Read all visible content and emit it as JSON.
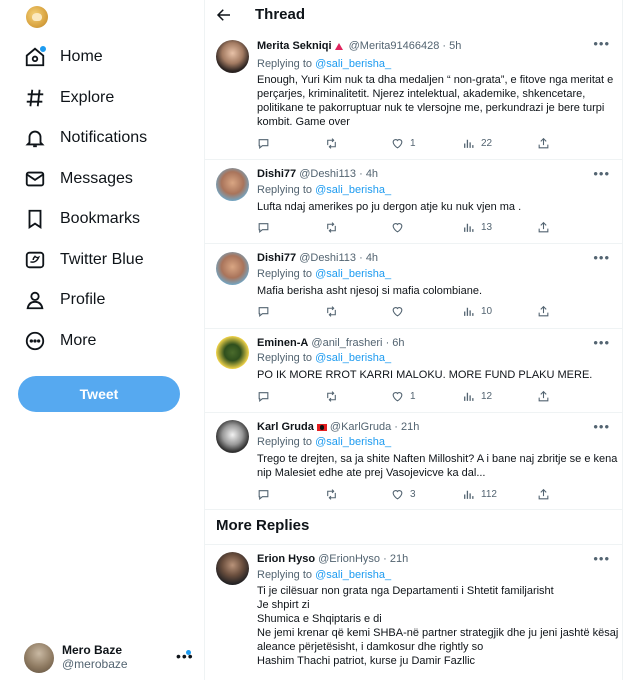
{
  "sidebar": {
    "nav": [
      {
        "label": "Home",
        "icon": "home-icon"
      },
      {
        "label": "Explore",
        "icon": "hashtag-icon"
      },
      {
        "label": "Notifications",
        "icon": "bell-icon"
      },
      {
        "label": "Messages",
        "icon": "envelope-icon"
      },
      {
        "label": "Bookmarks",
        "icon": "bookmark-icon"
      },
      {
        "label": "Twitter Blue",
        "icon": "twitter-blue-icon"
      },
      {
        "label": "Profile",
        "icon": "person-icon"
      },
      {
        "label": "More",
        "icon": "more-circle-icon"
      }
    ],
    "tweet_button": "Tweet",
    "account": {
      "name": "Mero Baze",
      "handle": "@merobaze"
    }
  },
  "header": {
    "title": "Thread"
  },
  "colors": {
    "accent": "#1d9bf0",
    "tweet_button": "#56a9f0"
  },
  "tweets": [
    {
      "name": "Merita Sekniqi",
      "handle": "@Merita91466428",
      "time": "· 5h",
      "replying_prefix": "Replying to ",
      "replying_to": "@sali_berisha_",
      "lines": [
        "Enough, Yuri Kim nuk ta dha medaljen “ non-grata”, e fitove nga meritat e",
        "perçarjes, kriminalitetit. Njerez intelektual, akademike, shkencetare,",
        "politikane te pakorruptuar nuk te vlersojne me, perkundrazi je bere turpi",
        "kombit. Game over"
      ],
      "likes": "1",
      "views": "22"
    },
    {
      "name": "Dishi77",
      "handle": "@Deshi113",
      "time": "· 4h",
      "replying_prefix": "Replying to ",
      "replying_to": "@sali_berisha_",
      "lines": [
        "Lufta ndaj amerikes po ju dergon atje ku nuk vjen ma ."
      ],
      "likes": "",
      "views": "13"
    },
    {
      "name": "Dishi77",
      "handle": "@Deshi113",
      "time": "· 4h",
      "replying_prefix": "Replying to ",
      "replying_to": "@sali_berisha_",
      "lines": [
        "Mafia berisha asht njesoj si mafia colombiane."
      ],
      "likes": "",
      "views": "10"
    },
    {
      "name": "Eminen-A",
      "handle": "@anil_frasheri",
      "time": "· 6h",
      "replying_prefix": "Replying to ",
      "replying_to": "@sali_berisha_",
      "lines": [
        "PO IK MORE RROT KARRI MALOKU. MORE FUND PLAKU MERE."
      ],
      "likes": "1",
      "views": "12"
    },
    {
      "name": "Karl Gruda",
      "handle": "@KarlGruda",
      "time": "· 21h",
      "replying_prefix": "Replying to ",
      "replying_to": "@sali_berisha_",
      "lines": [
        "Trego te drejten, sa ja shite Naften Milloshit? A i bane naj zbritje se e kena",
        "nip Malesiet edhe ate prej Vasojevicve ka dal..."
      ],
      "likes": "3",
      "views": "112"
    },
    {
      "name": "Erion Hyso",
      "handle": "@ErionHyso",
      "time": "· 21h",
      "replying_prefix": "Replying to ",
      "replying_to": "@sali_berisha_",
      "lines": [
        "Ti je cilësuar non grata nga Departamenti i Shtetit familjarisht",
        "Je shpirt zi",
        "Shumica e Shqiptaris e di",
        "Ne jemi krenar që kemi SHBA-në partner strategjik dhe ju jeni jashtë kësaj",
        "aleance përjetësisht, i damkosur dhe rightly so",
        "Hashim Thachi patriot, kurse ju Damir Fazllic"
      ],
      "likes": "",
      "views": ""
    }
  ],
  "more_replies_title": "More Replies"
}
